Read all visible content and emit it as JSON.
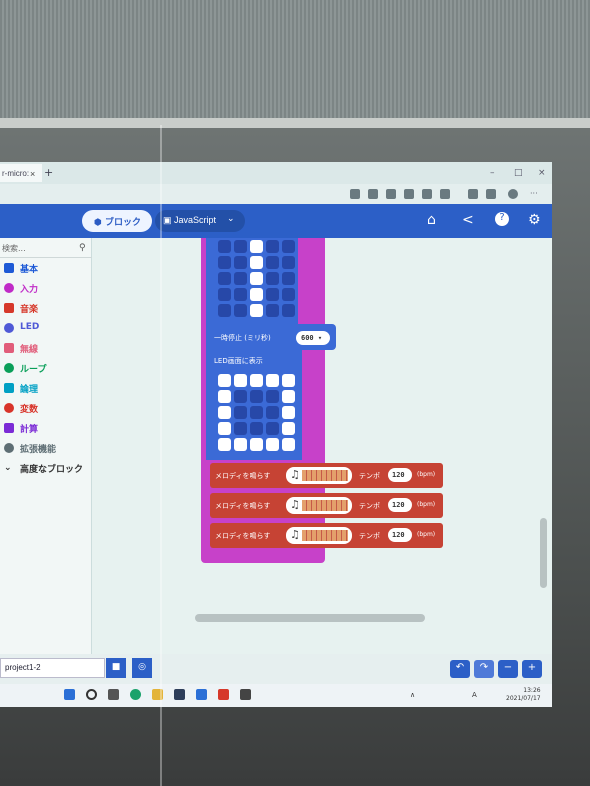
{
  "browser": {
    "tab_title": "r-micro:",
    "tab_close": "×",
    "new_tab": "+",
    "min": "–",
    "max": "□",
    "close": "×"
  },
  "header": {
    "blocks_label": "ブロック",
    "javascript_label": "JavaScript",
    "dropdown": "⌄",
    "home_icon": "⌂",
    "share_icon": "<",
    "help_icon": "?",
    "settings_icon": "⚙"
  },
  "sidebar": {
    "search_placeholder": "検索...",
    "search_glyph": "⚲",
    "categories": [
      {
        "label": "基本",
        "color": "#1e5ad6"
      },
      {
        "label": "入力",
        "color": "#c02bc7"
      },
      {
        "label": "音楽",
        "color": "#d6382a"
      },
      {
        "label": "LED",
        "color": "#4f59d6"
      },
      {
        "label": "無線",
        "color": "#e15d7a"
      },
      {
        "label": "ループ",
        "color": "#0a9f59"
      },
      {
        "label": "論理",
        "color": "#00a0c4"
      },
      {
        "label": "変数",
        "color": "#d8342a"
      },
      {
        "label": "計算",
        "color": "#7b2bd6"
      },
      {
        "label": "拡張機能",
        "color": "#5e6e74"
      },
      {
        "label": "高度なブロック",
        "color": "#333333"
      }
    ],
    "advanced_chevron": "⌄"
  },
  "blocks": {
    "pause_label": "一時停止 (ミリ秒)",
    "pause_value": "600 ▾",
    "show_leds_label": "LED画面に表示",
    "melody_label": "メロディを鳴らす",
    "melody_note": "♫",
    "tempo_label": "テンポ",
    "tempo_value": "120",
    "bpm_label": "(bpm)",
    "top_grid": [
      [
        0,
        0,
        1,
        0,
        0
      ],
      [
        0,
        0,
        1,
        0,
        0
      ],
      [
        0,
        0,
        1,
        0,
        0
      ],
      [
        0,
        0,
        1,
        0,
        0
      ],
      [
        0,
        0,
        1,
        0,
        0
      ]
    ],
    "bottom_grid": [
      [
        1,
        1,
        1,
        1,
        1
      ],
      [
        1,
        0,
        0,
        0,
        1
      ],
      [
        1,
        0,
        0,
        0,
        1
      ],
      [
        1,
        0,
        0,
        0,
        1
      ],
      [
        1,
        1,
        1,
        1,
        1
      ]
    ]
  },
  "footer": {
    "project_name": "project1-2",
    "save_glyph": "💾",
    "github_glyph": "◎",
    "undo_glyph": "↶",
    "redo_glyph": "↷",
    "zoom_out_glyph": "−",
    "zoom_in_glyph": "+"
  },
  "taskbar": {
    "tray_up": "∧",
    "tray_lang": "A",
    "time": "13:26",
    "date": "2021/07/17"
  }
}
